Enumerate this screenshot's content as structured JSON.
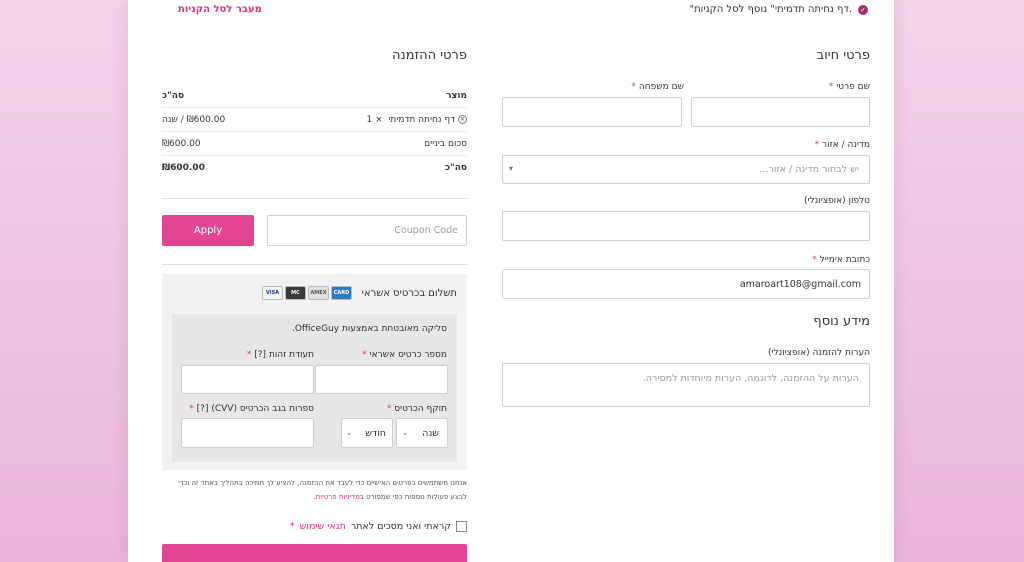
{
  "notice": {
    "message": "\"דף נחיתה תדמיתי\" נוסף לסל הקניות.",
    "go_to_cart": "מעבר לסל הקניות"
  },
  "billing": {
    "title": "פרטי חיוב",
    "first_name_label": "שם פרטי",
    "last_name_label": "שם משפחה",
    "country_label": "מדינה / אזור",
    "country_placeholder": "יש לבחור מדינה / אזור…",
    "phone_label": "טלפון (אופציונלי)",
    "email_label": "כתובת אימייל",
    "email_value": "amaroart108@gmail.com",
    "required_mark": "*"
  },
  "additional": {
    "title": "מידע נוסף",
    "notes_label": "הערות להזמנה (אופציונלי)",
    "notes_placeholder": "הערות על ההזמנה, לדוגמה, הערות מיוחדות למסירה."
  },
  "order": {
    "title": "פרטי ההזמנה",
    "col_product": "מוצר",
    "col_total": "סה\"כ",
    "item_name": "דף נחיתה תדמיתי",
    "item_qty": "× 1",
    "item_price": "₪600.00 / שנה",
    "subtotal_label": "סכום ביניים",
    "subtotal_value": "₪600.00",
    "total_label": "סה\"כ",
    "total_value": "₪600.00"
  },
  "coupon": {
    "placeholder": "Coupon Code",
    "apply_label": "Apply"
  },
  "payment": {
    "method_label": "תשלום בכרטיס אשראי",
    "secure_text": "סליקה מאובטחת באמצעות OfficeGuy.",
    "card_number_label": "מספר כרטיס אשראי",
    "id_label": "תעודת זהות",
    "help_mark": "[?]",
    "expiry_label": "תוקף הכרטיס",
    "cvv_label": "ספרות בגב הכרטיס (CVV)",
    "year_placeholder": "שנה",
    "month_placeholder": "חודש",
    "card_brands": [
      "VISA",
      "MC",
      "AMEX",
      "CARD"
    ]
  },
  "privacy": {
    "text": "אנחנו משתמשים בפרטים האישיים כדי לעבד את ההזמנה, להציע לך תמיכה בתהליך באתר זה וכדי לבצע פעולות נוספות כפי שמפורט ב",
    "link": "מדיניות פרטיות",
    "end": "."
  },
  "terms": {
    "text": "קראתי ואני מסכים לאתר",
    "link": "תנאי שימוש",
    "required_mark": "*"
  },
  "colors": {
    "accent": "#e24592",
    "link": "#d2367f",
    "background": "#f4d3ea"
  }
}
